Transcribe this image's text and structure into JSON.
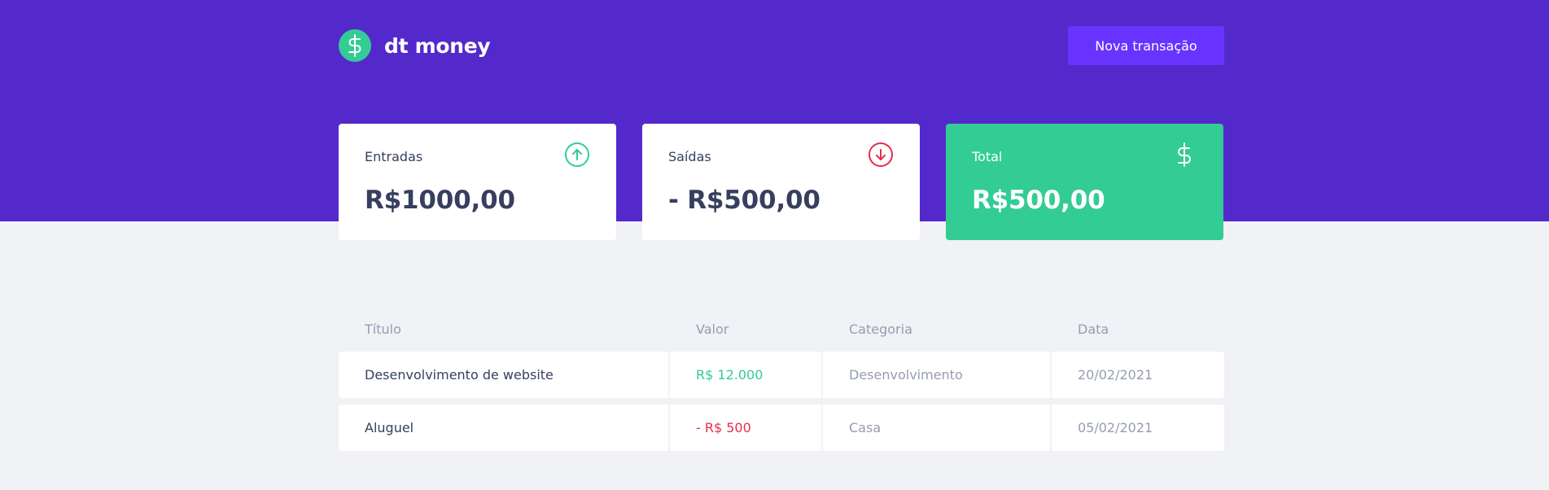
{
  "app": {
    "name": "dt money",
    "new_transaction_label": "Nova transação"
  },
  "summary": {
    "income": {
      "label": "Entradas",
      "value": "R$1000,00",
      "icon": "arrow-up-circle-icon"
    },
    "outcome": {
      "label": "Saídas",
      "value": "- R$500,00",
      "icon": "arrow-down-circle-icon"
    },
    "total": {
      "label": "Total",
      "value": "R$500,00",
      "icon": "dollar-sign-icon"
    }
  },
  "table": {
    "headers": [
      "Título",
      "Valor",
      "Categoria",
      "Data"
    ],
    "rows": [
      {
        "title": "Desenvolvimento de website",
        "amount": "R$ 12.000",
        "category": "Desenvolvimento",
        "date": "20/02/2021",
        "type": "deposit"
      },
      {
        "title": "Aluguel",
        "amount": "- R$ 500",
        "category": "Casa",
        "date": "05/02/2021",
        "type": "withdraw"
      }
    ]
  },
  "colors": {
    "header_bg": "#5429CC",
    "button_bg": "#6933FF",
    "green": "#33CC95",
    "red": "#E52E4D",
    "text_title": "#363F5F",
    "text_body": "#969CB3",
    "background": "#F0F2F5"
  }
}
